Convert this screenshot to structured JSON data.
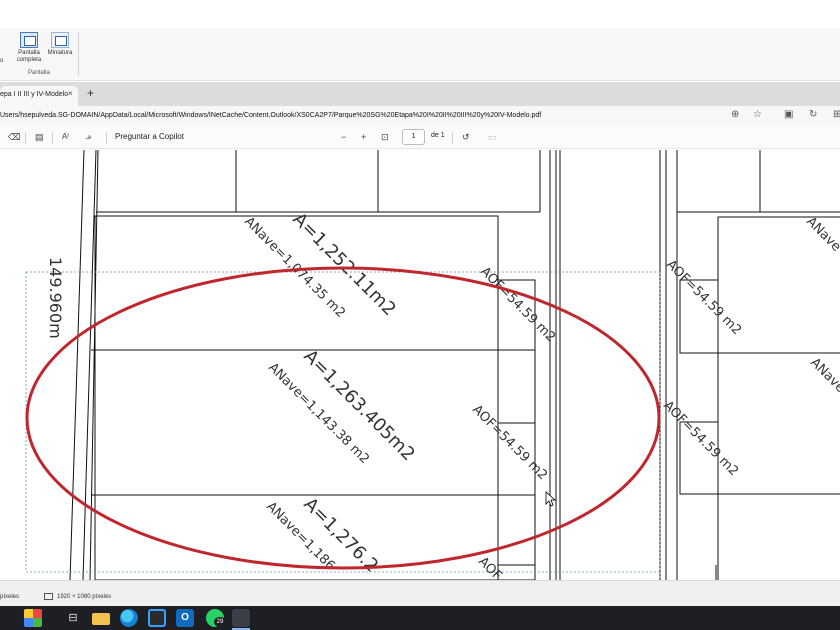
{
  "ribbon": {
    "cut_label": "o",
    "buttons": [
      {
        "label": "Pantalla completa"
      },
      {
        "label": "Miniatura"
      }
    ],
    "group_label": "Pantalla"
  },
  "browser": {
    "tab_title": "epa I II III y IV-Modelo",
    "tab_close": "×",
    "new_tab": "+",
    "address": "Users/hsepulveda.SG-DOMAIN/AppData/Local/Microsoft/Windows/INetCache/Content.Outlook/XS0CA2P7/Parque%20SG%20Etapa%20I%20II%20III%20y%20IV-Modelo.pdf",
    "zoom_icon": "zoom-icon",
    "star_icon": "star-icon"
  },
  "pdf_toolbar": {
    "copilot_label": "Preguntar a Copilot",
    "zoom_out": "−",
    "zoom_in": "+",
    "page_current": "1",
    "page_total": "de 1"
  },
  "drawing": {
    "left_dimension": "149.960m",
    "lots": [
      {
        "area": "A=1,252.11m2",
        "nave": "ANave=1,074.35 m2",
        "aof": "AOF=54.59 m2"
      },
      {
        "area": "A=1,263.405m2",
        "nave": "ANave=1,143.38 m2",
        "aof": "AOF=54.59 m2"
      },
      {
        "area": "A=1,276.2",
        "nave": "ANave=1,186",
        "aof": "AOF"
      }
    ],
    "right_lots": [
      {
        "aof": "AOF=54.59 m2",
        "nave": "ANave"
      },
      {
        "aof": "AOF=54.59 m2",
        "nave": "ANave"
      }
    ],
    "highlight_color": "#c0262d"
  },
  "status": {
    "left": "píxeles",
    "dimensions": "1920 × 1080 píxeles"
  },
  "taskbar": {
    "whatsapp_badge": "29",
    "outlook_letter": "O",
    "task_view": "⊟"
  }
}
